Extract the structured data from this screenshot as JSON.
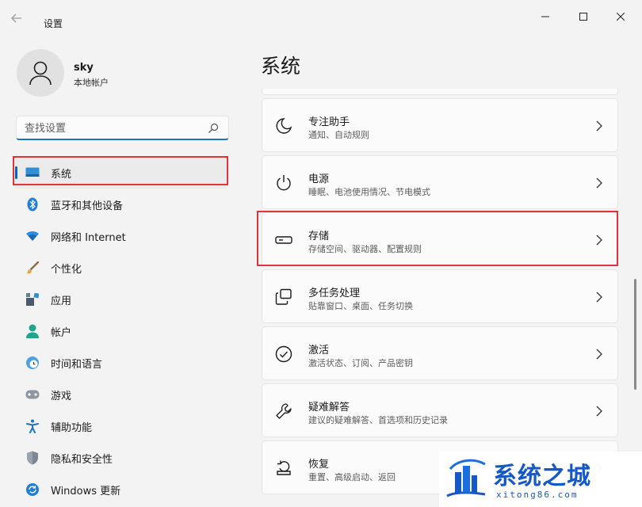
{
  "window": {
    "title": "设置"
  },
  "user": {
    "name": "sky",
    "account_type": "本地帐户"
  },
  "search": {
    "placeholder": "查找设置"
  },
  "nav": [
    {
      "label": "系统",
      "icon": "system-icon",
      "active": true
    },
    {
      "label": "蓝牙和其他设备",
      "icon": "bluetooth-icon"
    },
    {
      "label": "网络和 Internet",
      "icon": "wifi-icon"
    },
    {
      "label": "个性化",
      "icon": "brush-icon"
    },
    {
      "label": "应用",
      "icon": "apps-icon"
    },
    {
      "label": "帐户",
      "icon": "account-icon"
    },
    {
      "label": "时间和语言",
      "icon": "clock-globe-icon"
    },
    {
      "label": "游戏",
      "icon": "gamepad-icon"
    },
    {
      "label": "辅助功能",
      "icon": "accessibility-icon"
    },
    {
      "label": "隐私和安全性",
      "icon": "shield-icon"
    },
    {
      "label": "Windows 更新",
      "icon": "update-icon"
    }
  ],
  "main": {
    "title": "系统",
    "cards": [
      {
        "title": "专注助手",
        "subtitle": "通知、自动规则",
        "icon": "moon-icon"
      },
      {
        "title": "电源",
        "subtitle": "睡眠、电池使用情况、节电模式",
        "icon": "power-icon"
      },
      {
        "title": "存储",
        "subtitle": "存储空间、驱动器、配置规则",
        "icon": "storage-icon"
      },
      {
        "title": "多任务处理",
        "subtitle": "贴靠窗口、桌面、任务切换",
        "icon": "multitask-icon"
      },
      {
        "title": "激活",
        "subtitle": "激活状态、订阅、产品密钥",
        "icon": "check-circle-icon"
      },
      {
        "title": "疑难解答",
        "subtitle": "建议的疑难解答、首选项和历史记录",
        "icon": "wrench-icon"
      },
      {
        "title": "恢复",
        "subtitle": "重置、高级启动、返回",
        "icon": "recovery-icon"
      }
    ]
  },
  "watermark": {
    "text": "系统之城",
    "url": "xitong86.com"
  },
  "colors": {
    "accent": "#0067c0",
    "highlight": "#e0333a",
    "watermark": "#1459c7"
  }
}
